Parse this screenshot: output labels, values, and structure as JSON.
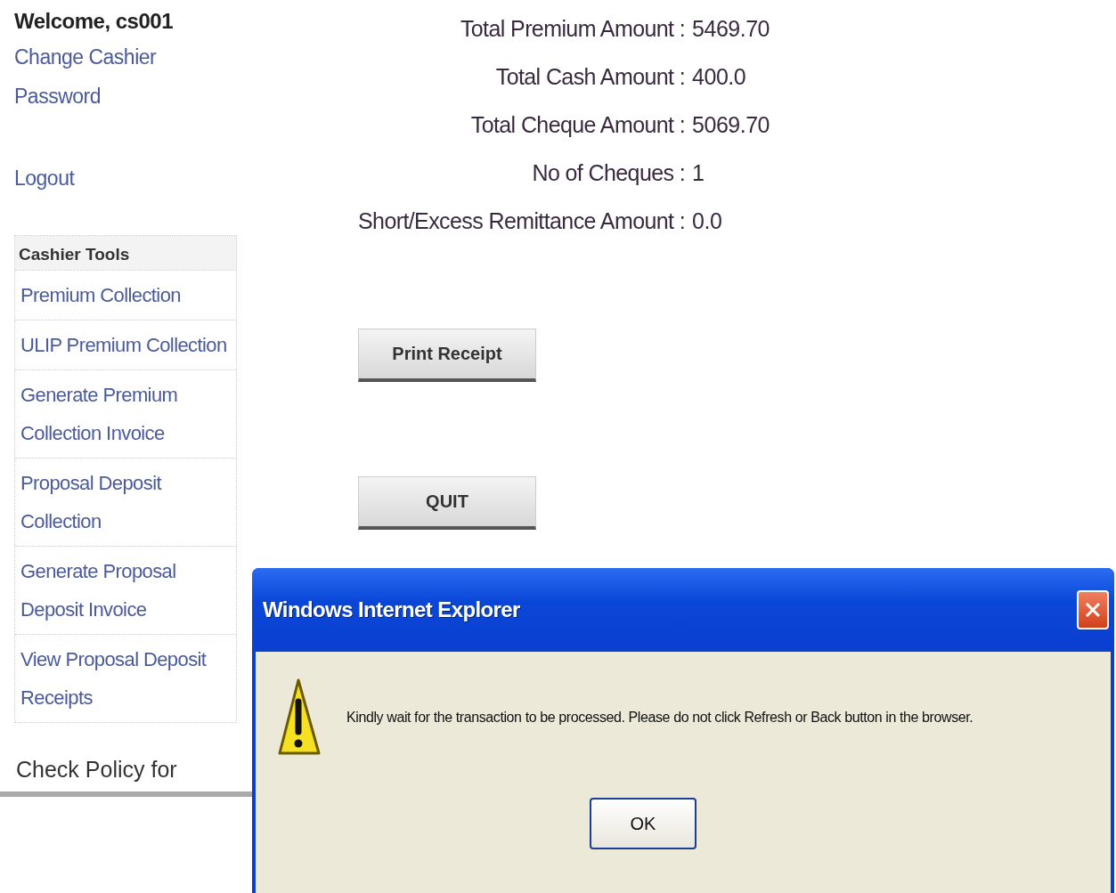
{
  "sidebar": {
    "welcome": "Welcome, cs001",
    "links": [
      {
        "label": "Change Cashier Password"
      },
      {
        "label": "Logout"
      }
    ],
    "tools": {
      "title": "Cashier Tools",
      "items": [
        {
          "label": "Premium Collection"
        },
        {
          "label": "ULIP Premium Collection"
        },
        {
          "label": "Generate Premium Collection Invoice"
        },
        {
          "label": "Proposal Deposit Collection"
        },
        {
          "label": "Generate Proposal Deposit Invoice"
        },
        {
          "label": "View Proposal Deposit Receipts"
        }
      ]
    },
    "footer_text": "Check Policy for"
  },
  "summary": [
    {
      "label": "Total Premium Amount :",
      "value": "5469.70"
    },
    {
      "label": "Total Cash Amount :",
      "value": "400.0"
    },
    {
      "label": "Total Cheque Amount :",
      "value": "5069.70"
    },
    {
      "label": "No of Cheques :",
      "value": "1"
    },
    {
      "label": "Short/Excess Remittance Amount :",
      "value": "0.0"
    }
  ],
  "buttons": [
    "Print Receipt",
    "QUIT"
  ],
  "dialog": {
    "title": "Windows Internet Explorer",
    "message": "Kindly wait for the transaction to be processed. Please do not click Refresh or Back button in the browser.",
    "button": "OK"
  }
}
